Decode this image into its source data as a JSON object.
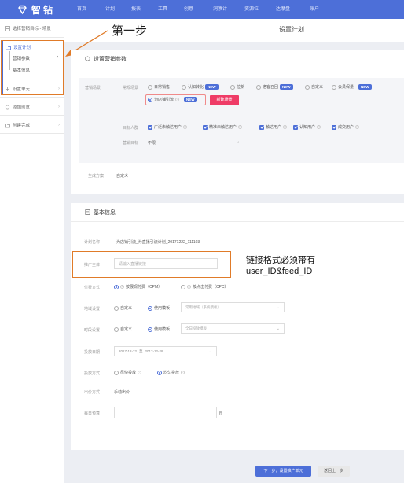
{
  "app": {
    "logo_text": "智钻"
  },
  "nav": [
    "首页",
    "计划",
    "报表",
    "工具",
    "创意",
    "洞察计",
    "资源位",
    "达摩盘",
    "账户"
  ],
  "sidebar": {
    "top_item": "选择营销目标 - 场景",
    "active_section": "设置计划",
    "sub_items": [
      "营销参数",
      "基本信息"
    ],
    "items": [
      "设置单元",
      "添加创意",
      "创建完成"
    ]
  },
  "annotation": {
    "step": "第一步",
    "note_line1": "链接格式必须带有",
    "note_line2": "user_ID&feed_ID"
  },
  "header": {
    "title": "设置计划"
  },
  "marketing": {
    "title": "设置营销参数",
    "goal_label": "营销场景",
    "sub_label": "常规场景",
    "options": [
      {
        "label": "日常销售",
        "badge": ""
      },
      {
        "label": "认知转化",
        "badge": "NEW"
      },
      {
        "label": "拉新",
        "badge": ""
      },
      {
        "label": "老客召回",
        "badge": "NEW"
      },
      {
        "label": "自定义",
        "badge": ""
      },
      {
        "label": "会员保量",
        "badge": "NEW"
      }
    ],
    "selected_option": {
      "label": "为店铺引流",
      "badge": "NEW"
    },
    "pink_button": "新建场景",
    "target_label": "目标人群",
    "targets": [
      "广泛未触达用户",
      "精准未触达用户",
      "触达用户",
      "认知用户",
      "成交用户"
    ],
    "goal_label2": "营销目标",
    "goal_value": "不限",
    "goal_dot": "，",
    "plan_label": "生成方案",
    "plan_value": "自定义"
  },
  "basic": {
    "title": "基本信息",
    "plan_name_label": "计划名称",
    "plan_name_value": "为店铺引流_为直播引流计划_20171222_111103",
    "promo_label": "推广主体",
    "promo_placeholder": "请输入直播链接",
    "pay_label": "付费方式",
    "pay_opt1": "按展现付费（CPM）",
    "pay_opt2": "按点击付费（CPC）",
    "region_label": "地域设置",
    "region_opt1": "自定义",
    "region_opt2": "使用模板",
    "region_dropdown": "常用地域（系统模板）",
    "time_label": "时段设置",
    "time_opt1": "自定义",
    "time_opt2": "使用模板",
    "time_dropdown": "全日投放模板",
    "date_label": "投放日期",
    "date_start": "2017-12-22",
    "date_sep": "至",
    "date_end": "2017-12-28",
    "method_label": "投放方式",
    "method_opt1": "尽快投放",
    "method_opt2": "均匀投放",
    "bid_label": "出价方式",
    "bid_value": "手动出价",
    "budget_label": "每日预算",
    "budget_unit": "元"
  },
  "buttons": {
    "next": "下一步，设置推广单元",
    "back": "返回上一步"
  },
  "colors": {
    "brand": "#4d6fd8",
    "highlight": "#e07b29",
    "pink": "#ef3c67"
  }
}
